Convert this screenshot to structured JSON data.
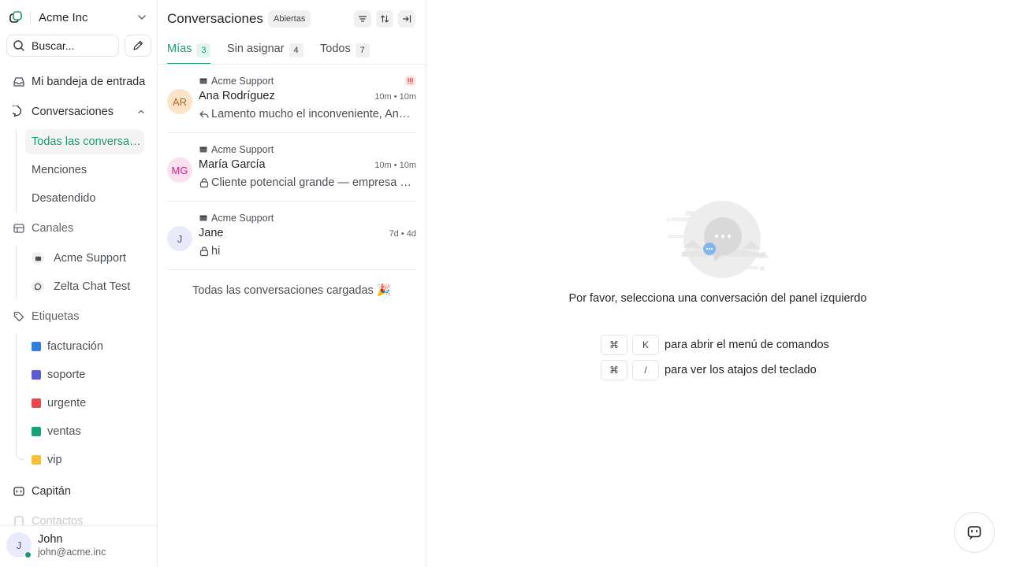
{
  "account": {
    "name": "Acme Inc"
  },
  "search": {
    "placeholder": "Buscar..."
  },
  "nav": {
    "inbox": "Mi bandeja de entrada",
    "conversations": "Conversaciones",
    "conv_children": [
      "Todas las conversaciones",
      "Menciones",
      "Desatendido"
    ],
    "channels": "Canales",
    "channel_items": [
      "Acme Support",
      "Zelta Chat Test"
    ],
    "labels": "Etiquetas",
    "label_items": [
      {
        "name": "facturación",
        "color": "#2f7de1"
      },
      {
        "name": "soporte",
        "color": "#5b5bd6"
      },
      {
        "name": "urgente",
        "color": "#e5484d"
      },
      {
        "name": "ventas",
        "color": "#12a37a"
      },
      {
        "name": "vip",
        "color": "#f5c034"
      }
    ],
    "captain": "Capitán",
    "contacts": "Contactos"
  },
  "user": {
    "initial": "J",
    "name": "John",
    "email": "john@acme.inc"
  },
  "list": {
    "title": "Conversaciones",
    "status": "Abiertas",
    "tabs": [
      {
        "label": "Mías",
        "count": "3"
      },
      {
        "label": "Sin asignar",
        "count": "4"
      },
      {
        "label": "Todos",
        "count": "7"
      }
    ],
    "conversations": [
      {
        "initials": "AR",
        "inbox": "Acme Support",
        "name": "Ana Rodríguez",
        "time": "10m • 10m",
        "preview": "Lamento mucho el inconveniente, Ana. He revisado tu cuenta",
        "preview_icon": "reply-icon",
        "avatar_bg": "#fde4c8",
        "avatar_fg": "#b5651d"
      },
      {
        "initials": "MG",
        "inbox": "Acme Support",
        "name": "María García",
        "time": "10m • 10m",
        "preview": "Cliente potencial grande — empresa de logística interesada",
        "preview_icon": "lock-icon",
        "avatar_bg": "#fbe0f0",
        "avatar_fg": "#c2298a"
      },
      {
        "initials": "J",
        "inbox": "Acme Support",
        "name": "Jane",
        "time": "7d • 4d",
        "preview": "hi",
        "preview_icon": "lock-icon",
        "avatar_bg": "#e9ebfa",
        "avatar_fg": "#4a55a8"
      }
    ],
    "all_loaded": "Todas las conversaciones cargadas 🎉"
  },
  "empty": {
    "message": "Por favor, selecciona una conversación del panel izquierdo",
    "shortcuts": [
      {
        "key1": "⌘",
        "key2": "K",
        "desc": "para abrir el menú de comandos"
      },
      {
        "key1": "⌘",
        "key2": "/",
        "desc": "para ver los atajos del teclado"
      }
    ]
  }
}
